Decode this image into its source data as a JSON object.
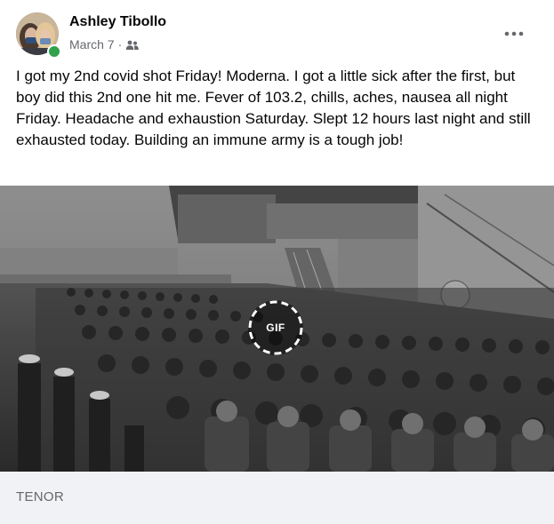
{
  "post": {
    "author": "Ashley Tibollo",
    "date": "March 7",
    "separator": "·",
    "audience_icon": "friends-icon",
    "more_icon": "more-options-icon",
    "text": "I got my 2nd covid shot Friday! Moderna. I got a little sick after the first, but boy did this 2nd one hit me. Fever of 103.2, chills, aches, nausea all night Friday. Headache and exhaustion Saturday. Slept 12 hours last night and still exhausted today. Building an immune army is a tough job!",
    "online_status_color": "#31a24c"
  },
  "gif": {
    "badge_label": "GIF",
    "source": "TENOR"
  }
}
